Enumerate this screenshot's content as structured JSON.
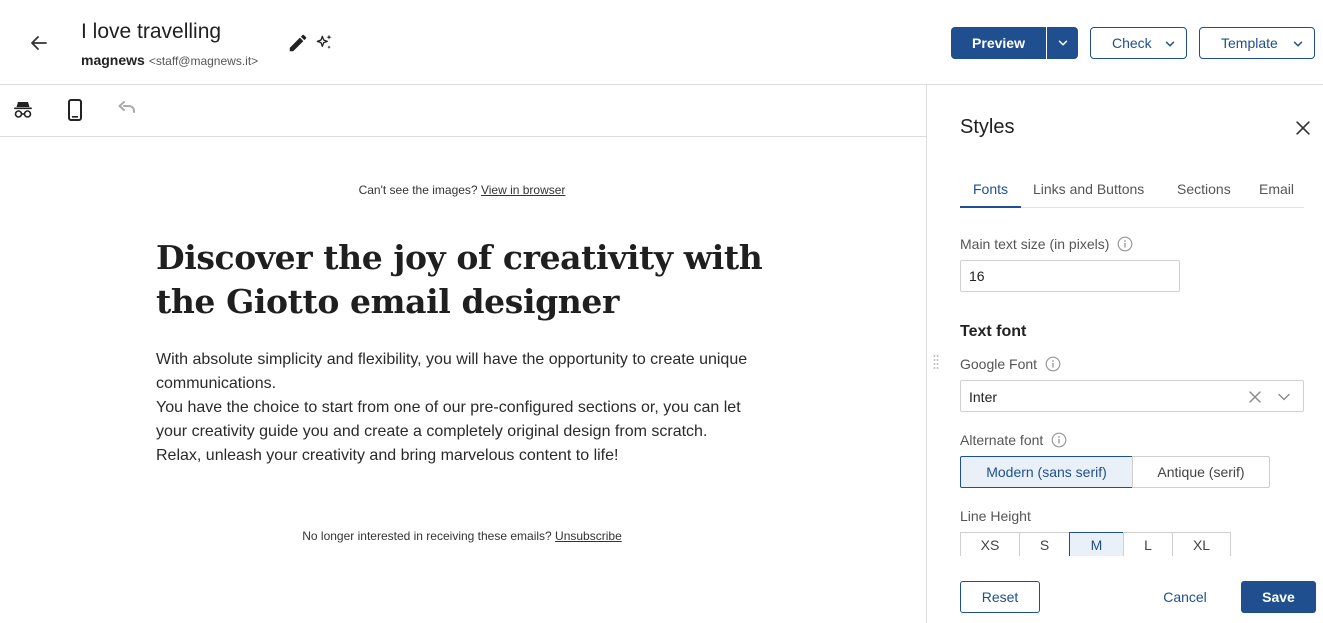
{
  "header": {
    "title": "I love travelling",
    "sender_name": "magnews",
    "sender_email": "<staff@magnews.it>",
    "back_icon": "arrow-left-icon",
    "edit_icon": "pencil-icon",
    "ai_icon": "sparkles-icon"
  },
  "actions": {
    "preview_label": "Preview",
    "check_label": "Check",
    "template_label": "Template"
  },
  "toolbar": {
    "icons": [
      "incognito-icon",
      "mobile-device-icon",
      "undo-icon"
    ]
  },
  "email": {
    "preheader_text": "Can't see the images?",
    "preheader_link": "View in browser",
    "headline": "Discover the joy of creativity with the Giotto email designer",
    "paragraphs": [
      "With absolute simplicity and flexibility, you will have the opportunity to create unique communications.",
      "You have the choice to start from one of our pre-configured sections or, you can let your creativity guide you and create a completely original design from scratch.",
      "Relax, unleash your creativity and bring marvelous content to life!"
    ],
    "footer_text": "No longer interested in receiving these emails?",
    "footer_link": "Unsubscribe"
  },
  "styles_panel": {
    "title": "Styles",
    "tabs": [
      "Fonts",
      "Links and Buttons",
      "Sections",
      "Email"
    ],
    "active_tab": "Fonts",
    "main_text_size_label": "Main text size (in pixels)",
    "main_text_size_value": "16",
    "text_font_heading": "Text font",
    "google_font_label": "Google Font",
    "google_font_value": "Inter",
    "alternate_font_label": "Alternate font",
    "alternate_font_options": [
      "Modern (sans serif)",
      "Antique (serif)"
    ],
    "alternate_font_selected": "Modern (sans serif)",
    "line_height_label": "Line Height",
    "line_height_options": [
      "XS",
      "S",
      "M",
      "L",
      "XL"
    ],
    "line_height_selected": "M",
    "reset_label": "Reset",
    "cancel_label": "Cancel",
    "save_label": "Save"
  },
  "colors": {
    "primary": "#1f4f8f",
    "selected_bg": "#eaf0f7",
    "border": "#dcdcdc"
  }
}
